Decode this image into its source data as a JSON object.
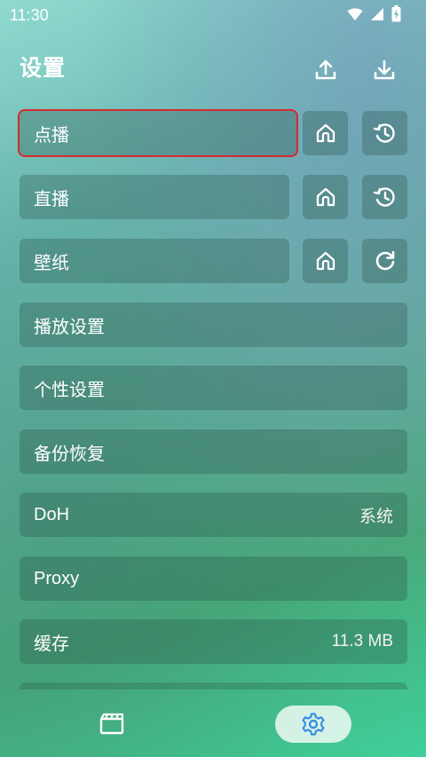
{
  "status_bar": {
    "time": "11:30"
  },
  "header": {
    "title": "设置"
  },
  "rows": [
    {
      "label": "点播"
    },
    {
      "label": "直播"
    },
    {
      "label": "壁纸"
    },
    {
      "label": "播放设置"
    },
    {
      "label": "个性设置"
    },
    {
      "label": "备份恢复"
    },
    {
      "label": "DoH",
      "value": "系统"
    },
    {
      "label": "Proxy"
    },
    {
      "label": "缓存",
      "value": "11.3 MB"
    }
  ],
  "icons": {
    "upload": "upload-icon",
    "download": "download-icon",
    "home": "home-icon",
    "history": "history-icon",
    "refresh": "refresh-icon",
    "video": "clapperboard-icon",
    "settings": "gear-icon"
  },
  "colors": {
    "accent": "#3a8fe0",
    "selection": "#d62a2f"
  }
}
